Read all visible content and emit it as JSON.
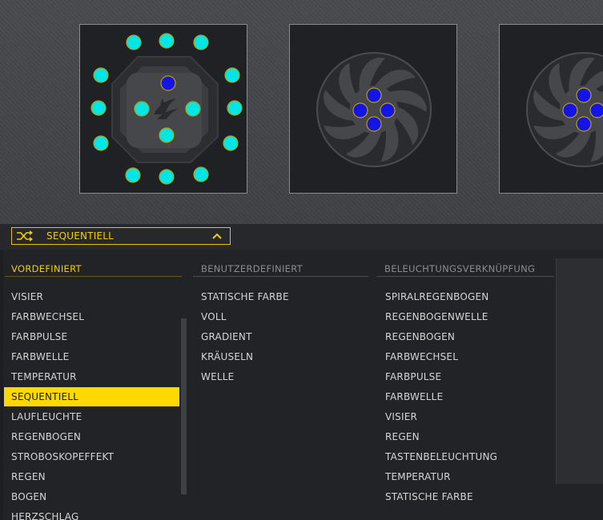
{
  "dropdown": {
    "selected": "SEQUENTIELL"
  },
  "columns": [
    {
      "header": "VORDEFINIERT",
      "active": true,
      "items": [
        "VISIER",
        "FARBWECHSEL",
        "FARBPULSE",
        "FARBWELLE",
        "TEMPERATUR",
        "SEQUENTIELL",
        "LAUFLEUCHTE",
        "REGENBOGEN",
        "STROBOSKOPEFFEKT",
        "REGEN",
        "BOGEN",
        "HERZSCHLAG"
      ],
      "selected_index": 5
    },
    {
      "header": "BENUTZERDEFINIERT",
      "active": false,
      "items": [
        "STATISCHE FARBE",
        "VOLL",
        "GRADIENT",
        "KRÄUSELN",
        "WELLE"
      ]
    },
    {
      "header": "BELEUCHTUNGSVERKNÜPFUNG",
      "active": false,
      "items": [
        "SPIRALREGENBOGEN",
        "REGENBOGENWELLE",
        "REGENBOGEN",
        "FARBWECHSEL",
        "FARBPULSE",
        "FARBWELLE",
        "VISIER",
        "REGEN",
        "TASTENBELEUCHTUNG",
        "TEMPERATUR",
        "STATISCHE FARBE"
      ]
    }
  ],
  "colors": {
    "accent": "#ffd800",
    "led_ring": "#00e5e5",
    "led_inner": "#1414e6",
    "header_inactive": "#8c8c8c"
  },
  "icons": {
    "mode": "shuffle-icon",
    "expand": "chevron-up-icon",
    "logo": "corsair-logo-icon"
  }
}
